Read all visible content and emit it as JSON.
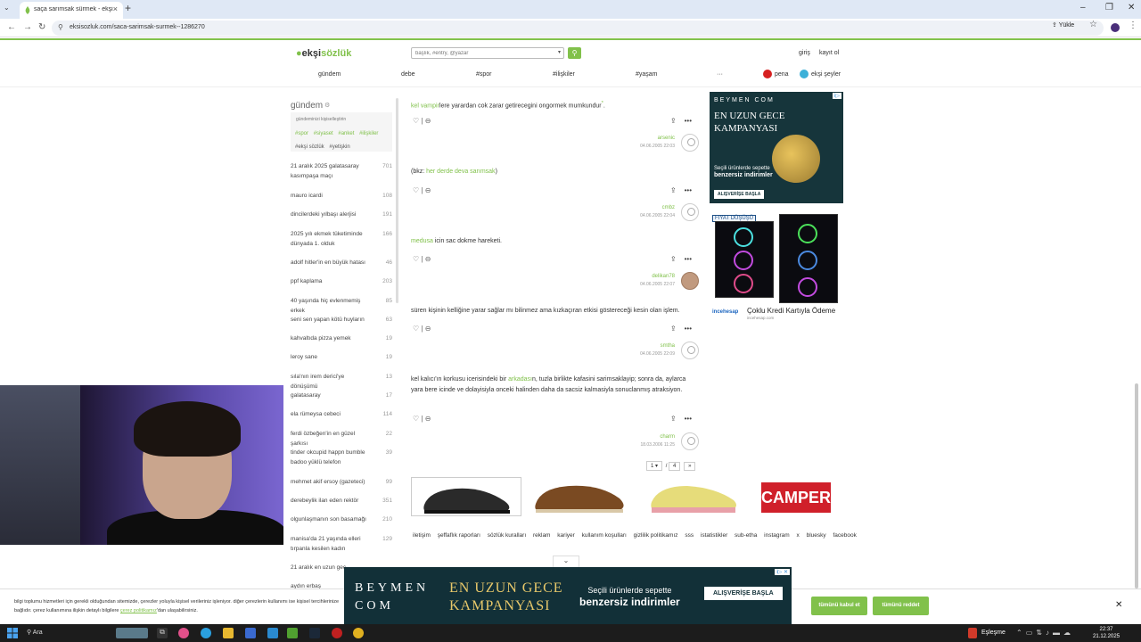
{
  "browser": {
    "tab_title": "saça sarımsak sürmek - ekşi sö",
    "url": "eksisozluk.com/saca-sarimsak-surmek--1286270",
    "upload_label": "Yükle"
  },
  "site": {
    "logo_prefix": "ekşi",
    "logo_suffix": "sözlük",
    "search_placeholder": "başlık, #entry, @yazar",
    "login": "giriş",
    "register": "kayıt ol",
    "nav": [
      "gündem",
      "debe",
      "#spor",
      "#ilişkiler",
      "#yaşam",
      "···"
    ],
    "pena": "pena",
    "eksi_seyler": "ekşi şeyler"
  },
  "sidebar": {
    "title": "gündem",
    "hint": "gündeminizi kişiselleştirin",
    "tags": [
      "#spor",
      "#siyaset",
      "#anket",
      "#ilişkiler",
      "#ekşi sözlük",
      "#yetişkin"
    ],
    "items": [
      {
        "title": "21 aralık 2025 galatasaray kasımpaşa maçı",
        "count": "701"
      },
      {
        "title": "mauro icardi",
        "count": "108"
      },
      {
        "title": "dincilerdeki yılbaşı alerjisi",
        "count": "191"
      },
      {
        "title": "2025 yılı ekmek tüketiminde dünyada 1. olduk",
        "count": "166"
      },
      {
        "title": "adolf hitler'in en büyük hatası",
        "count": "46"
      },
      {
        "title": "ppf kaplama",
        "count": "203"
      },
      {
        "title": "40 yaşında hiç evlenmemiş erkek",
        "count": "85"
      },
      {
        "title": "seni sen yapan kötü huyların",
        "count": "63"
      },
      {
        "title": "kahvaltıda pizza yemek",
        "count": "19"
      },
      {
        "title": "leroy sane",
        "count": "19"
      },
      {
        "title": "sıla'nın irem derici'ye dönüşümü",
        "count": "13"
      },
      {
        "title": "galatasaray",
        "count": "17"
      },
      {
        "title": "ela rümeysa cebeci",
        "count": "114"
      },
      {
        "title": "ferdi özbeğen'in en güzel şarkısı",
        "count": "22"
      },
      {
        "title": "tinder okcupid happn bumble badoo yüklü telefon",
        "count": "39"
      },
      {
        "title": "mehmet akif ersoy (gazeteci)",
        "count": "99"
      },
      {
        "title": "derebeylik ilan eden rektör",
        "count": "351"
      },
      {
        "title": "olgunlaşmanın son basamağı",
        "count": "210"
      },
      {
        "title": "manisa'da 21 yaşında elleri tırpanla kesilen kadın",
        "count": "129"
      },
      {
        "title": "21 aralık en uzun gec",
        "count": ""
      },
      {
        "title": "aydın erbaş",
        "count": ""
      }
    ]
  },
  "entries": [
    {
      "link": "kel vampir",
      "text": "lere yarardan cok zarar getirecegini ongormek mumkundur",
      "sup": "*",
      "tail": ".",
      "author": "arsenic",
      "date": "04.06.2005 22:03"
    },
    {
      "pre": "(bkz: ",
      "link": "her derde deva sarımsak",
      "text": ")",
      "author": "cmbz",
      "date": "04.06.2005 22:04"
    },
    {
      "link": "medusa",
      "text": " icin sac dokme hareketi.",
      "author": "delikan78",
      "date": "04.06.2005 22:07"
    },
    {
      "text": "süren kişinin kelliğine yarar sağlar mı bilinmez ama kızkaçıran etkisi göstereceği kesin olan işlem.",
      "author": "smtha",
      "date": "04.06.2005 22:09"
    },
    {
      "pre": "kel kalıcı'ın korkusu icerisindeki bir ",
      "link": "arkadası",
      "text": "n, tuzla birlikte kafasini sarimsaklayip; sonra da, aylarca yara bere icinde ve dolayisiyla onceki halinden daha da sacsiz kalmasiyla sonuclanmış atraksiyon.",
      "author": "charm",
      "date": "18.03.2006 11:25"
    }
  ],
  "pager": {
    "current": "1",
    "sep": "/",
    "total": "4",
    "next": "»"
  },
  "ads": {
    "beymen_brand": "BEYMEN COM",
    "beymen_headline": "EN UZUN GECE KAMPANYASI",
    "beymen_sub1": "Seçili ürünlerde sepette",
    "beymen_sub2": "benzersiz indirimler",
    "beymen_cta": "ALIŞVERİŞE BAŞLA",
    "fiyat": "FIYAT DÜŞÜŞÜ",
    "incehesap": "incehesap",
    "incehesap_text": "Çoklu Kredi Kartıyla Ödeme",
    "incehesap_sub": "incehesap.com",
    "camper": "CAMPER"
  },
  "footer": [
    "iletişim",
    "şeffaflık raporları",
    "sözlük kuralları",
    "reklam",
    "kariyer",
    "kullanım koşulları",
    "gizlilik politikamız",
    "sss",
    "istatistikler",
    "sub-etha",
    "instagram",
    "x",
    "bluesky",
    "facebook"
  ],
  "cookie": {
    "text": "bilgi toplumu hizmetleri için gerekli olduğundan sitemizde, çerezler yoluyla kişisel verileriniz işleniyor. diğer çerezlerin kullanımı ise kişisel tercihlerinize bağlıdır. çerez kullanımına ilişkin detaylı bilgilere",
    "link": "çerez politikamız",
    "tail": "'dan ulaşabilirsiniz.",
    "accept": "tümünü kabul et",
    "reject": "tümünü reddet"
  },
  "taskbar": {
    "search": "Ara",
    "status": "Eşleşme",
    "time": "22:37",
    "date": "21.12.2025"
  }
}
